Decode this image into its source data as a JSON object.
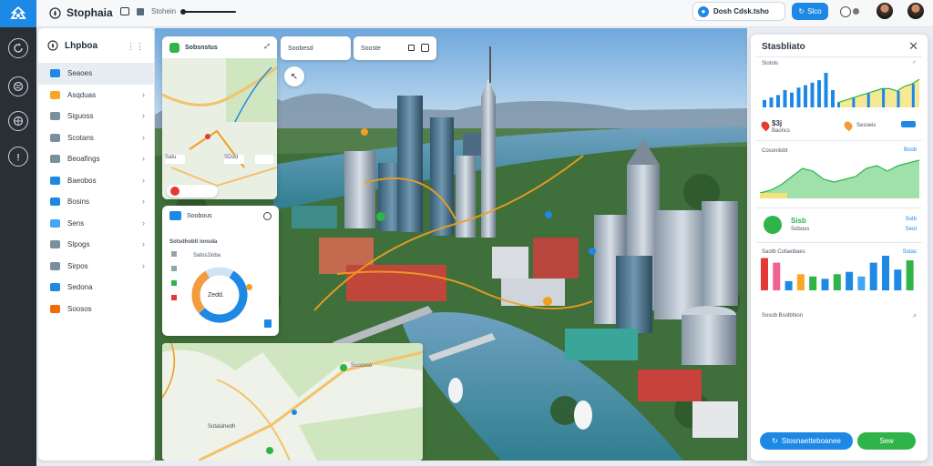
{
  "app": {
    "title": "Stophaia",
    "crumb_label": "Stohein"
  },
  "topbar": {
    "search_pill": "Dosh Cdsk.tsho",
    "action_label": "Slco"
  },
  "sidebar": {
    "title": "Lhpboa",
    "items": [
      {
        "label": "Seaoes",
        "color": "#1e88e5"
      },
      {
        "label": "Asqduas",
        "color": "#f9a825"
      },
      {
        "label": "Siguoss",
        "color": "#78909c"
      },
      {
        "label": "Scotans",
        "color": "#78909c"
      },
      {
        "label": "Beoafings",
        "color": "#78909c"
      },
      {
        "label": "Baeobos",
        "color": "#1e88e5"
      },
      {
        "label": "Bosins",
        "color": "#1e88e5"
      },
      {
        "label": "Sens",
        "color": "#42a5f5"
      },
      {
        "label": "Slpogs",
        "color": "#78909c"
      },
      {
        "label": "Sirpos",
        "color": "#78909c"
      },
      {
        "label": "Sedona",
        "color": "#1e88e5"
      },
      {
        "label": "Soosos",
        "color": "#ef6c00"
      }
    ]
  },
  "map_cards": {
    "nav_card": {
      "title": "Sobsnstus",
      "chip1": "Satu",
      "chip2": "SDdd"
    },
    "tab1": "Soobesd",
    "tab2": "Sooste",
    "stats_card": {
      "title": "Soobous",
      "subtitle": "Sotsdhobtl ionsda",
      "legend": "Satos2ioba",
      "center": "Zedd."
    },
    "mini_map": {
      "place1": "Sooosso",
      "place2": "Sotalahedh"
    }
  },
  "right_panel": {
    "title": "Stasbliato",
    "section1_label": "Siotols",
    "kpi1_value": "$3j",
    "kpi1_sub": "Baoncs",
    "kpi2_label": "Sesoeis",
    "section2_label": "Cosonilobt",
    "section2_value": "Boob",
    "kpi3_title": "Sisb",
    "kpi3_sub": "Sobous",
    "kpi3_val1": "Sotb",
    "kpi3_val2": "Seot",
    "section3_label": "Saotb Cofaeibaes",
    "section3_value": "Sotas",
    "footer_label": "Sosob Bsolbhion",
    "primary_button": "Stosnaetteboanee",
    "secondary_button": "Sew"
  },
  "chart_data": [
    {
      "type": "bar",
      "title": "Siotols",
      "series": [
        {
          "values": [
            3,
            4,
            5,
            7,
            6,
            8,
            9,
            10,
            11,
            14,
            7
          ]
        },
        {
          "values": [
            2,
            3,
            4,
            5,
            6,
            7,
            8,
            8,
            7,
            9,
            10,
            12
          ]
        }
      ]
    },
    {
      "type": "area",
      "title": "Cosonilobt",
      "series": [
        {
          "values": [
            2,
            3,
            5,
            8,
            11,
            10,
            7,
            6,
            7,
            8,
            11,
            12,
            10,
            12,
            13,
            14
          ]
        }
      ]
    },
    {
      "type": "bar",
      "title": "Saotb Cofaeibaes",
      "values": [
        14,
        12,
        4,
        7,
        6,
        5,
        7,
        8,
        6,
        12,
        15,
        9,
        13
      ]
    }
  ]
}
